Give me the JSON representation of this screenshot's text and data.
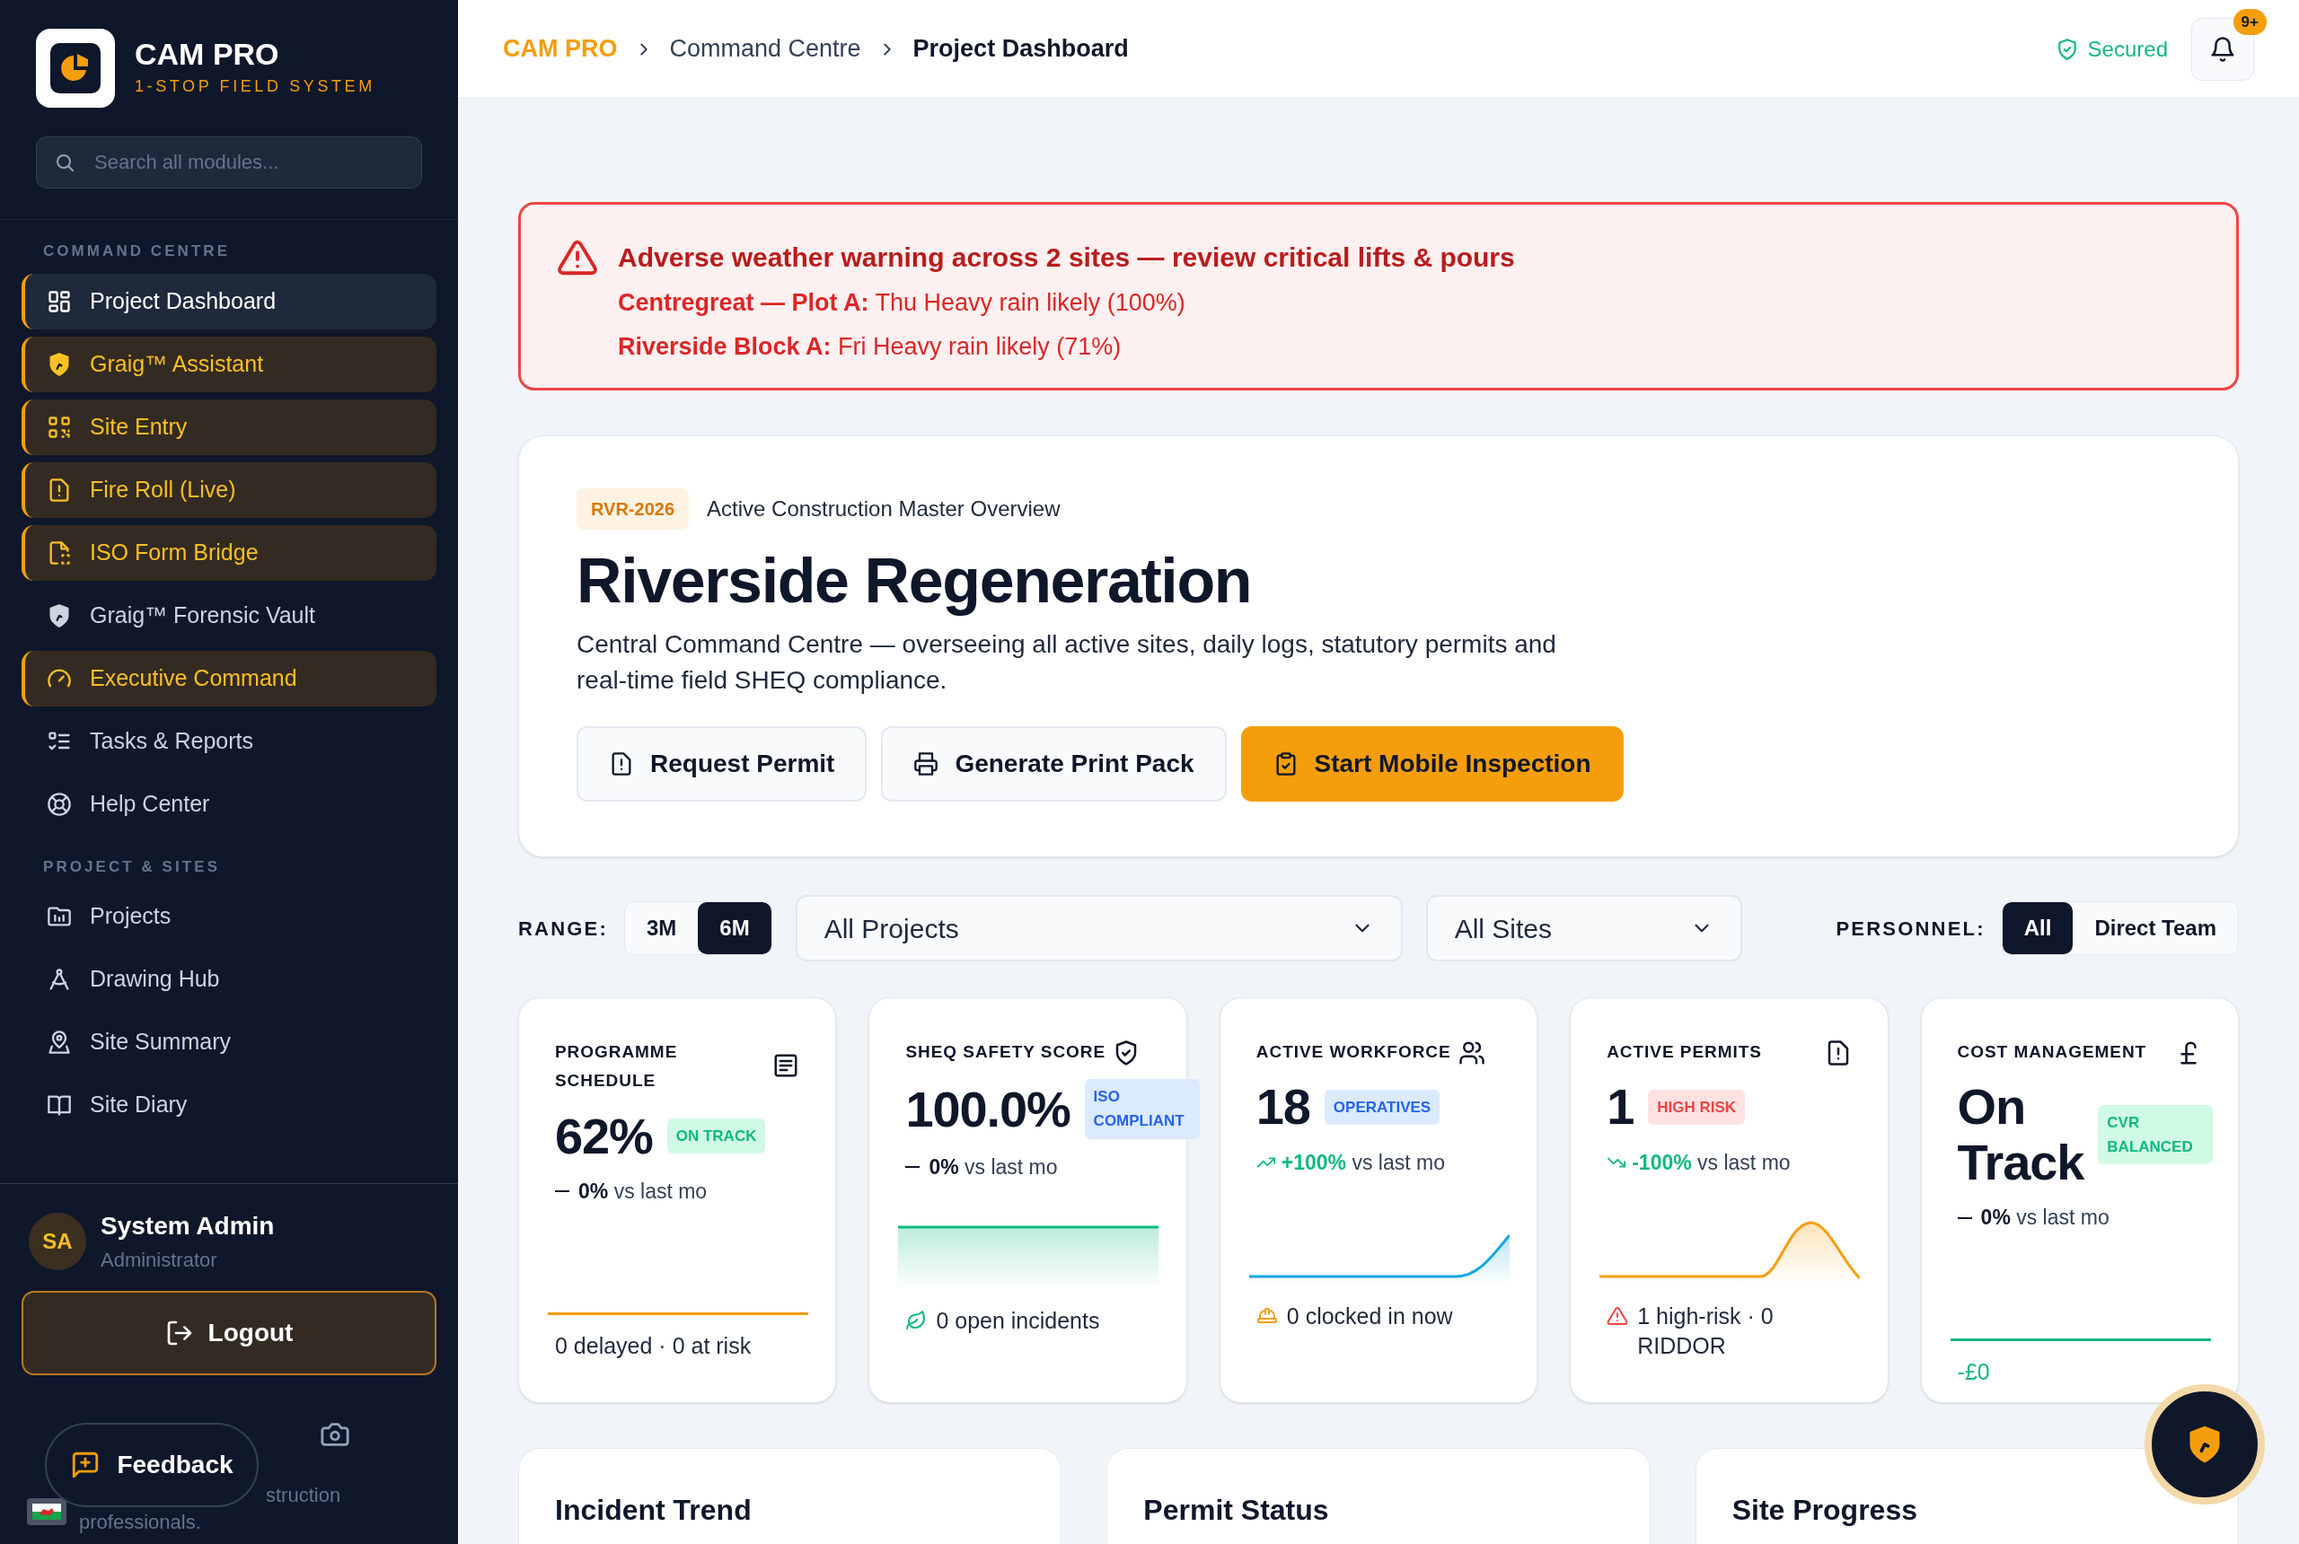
{
  "brand": {
    "name": "CAM PRO",
    "tagline": "1-STOP FIELD SYSTEM"
  },
  "search": {
    "placeholder": "Search all modules..."
  },
  "nav_sections": [
    {
      "title": "COMMAND CENTRE",
      "items": [
        {
          "label": "Project Dashboard",
          "selected": true,
          "highlighted": false
        },
        {
          "label": "Graig™ Assistant",
          "selected": false,
          "highlighted": true
        },
        {
          "label": "Site Entry",
          "selected": false,
          "highlighted": true
        },
        {
          "label": "Fire Roll (Live)",
          "selected": false,
          "highlighted": true
        },
        {
          "label": "ISO Form Bridge",
          "selected": false,
          "highlighted": true
        },
        {
          "label": "Graig™ Forensic Vault",
          "selected": false,
          "highlighted": false
        },
        {
          "label": "Executive Command",
          "selected": false,
          "highlighted": true
        },
        {
          "label": "Tasks & Reports",
          "selected": false,
          "highlighted": false
        },
        {
          "label": "Help Center",
          "selected": false,
          "highlighted": false
        }
      ]
    },
    {
      "title": "PROJECT & SITES",
      "items": [
        {
          "label": "Projects",
          "selected": false,
          "highlighted": false
        },
        {
          "label": "Drawing Hub",
          "selected": false,
          "highlighted": false
        },
        {
          "label": "Site Summary",
          "selected": false,
          "highlighted": false
        },
        {
          "label": "Site Diary",
          "selected": false,
          "highlighted": false
        }
      ]
    }
  ],
  "user": {
    "initials": "SA",
    "name": "System Admin",
    "role": "Administrator"
  },
  "logout": "Logout",
  "feedback": "Feedback",
  "footer_note": [
    "struction",
    "professionals."
  ],
  "breadcrumb": [
    "CAM PRO",
    "Command Centre",
    "Project Dashboard"
  ],
  "security": "Secured",
  "notifications": {
    "badge": "9+"
  },
  "alert": {
    "title": "Adverse weather warning across 2 sites — review critical lifts & pours",
    "lines": [
      "**Centregreat — Plot A:** Thu Heavy rain likely (100%)",
      "**Riverside Block A:** Fri Heavy rain likely (71%)"
    ]
  },
  "project": {
    "code": "RVR-2026",
    "subtitle": "Active Construction Master Overview",
    "title": "Riverside Regeneration",
    "description": "Central Command Centre — overseeing all active sites, daily logs, statutory permits and real-time field SHEQ compliance.",
    "actions": [
      {
        "label": "Request Permit",
        "primary": false
      },
      {
        "label": "Generate Print Pack",
        "primary": false
      },
      {
        "label": "Start Mobile Inspection",
        "primary": true
      }
    ]
  },
  "filters": {
    "range_label": "RANGE:",
    "ranges": [
      {
        "label": "3M",
        "selected": false
      },
      {
        "label": "6M",
        "selected": true
      }
    ],
    "project_select": "All Projects",
    "site_select": "All Sites",
    "personnel_label": "PERSONNEL:",
    "personnel": [
      {
        "label": "All",
        "selected": true
      },
      {
        "label": "Direct Team",
        "selected": false
      }
    ]
  },
  "kpis": [
    {
      "title": "PROGRAMME SCHEDULE",
      "value": "62%",
      "badge": "ON TRACK",
      "change": "**0%** vs last mo",
      "sparkline": {
        "color": "#f59e0b"
      },
      "footer": "0 delayed · 0 at risk"
    },
    {
      "title": "SHEQ SAFETY SCORE",
      "value": "100.0%",
      "badge": "ISO COMPLIANT",
      "change": "**0%** vs last mo",
      "sparkline": {
        "color": "#10b981"
      },
      "footer": "0 open incidents"
    },
    {
      "title": "ACTIVE WORKFORCE",
      "value": "18",
      "badge": "OPERATIVES",
      "change": "**+100%** vs last mo",
      "sparkline": {
        "color": "#0ea5e9"
      },
      "footer": "0 clocked in now"
    },
    {
      "title": "ACTIVE PERMITS",
      "value": "1",
      "badge": "HIGH RISK",
      "change": "**-100%** vs last mo",
      "sparkline": {
        "color": "#f59e0b"
      },
      "footer": "1 high-risk · 0 RIDDOR"
    },
    {
      "title": "COST MANAGEMENT",
      "value": "On Track",
      "badge": "CVR BALANCED",
      "change": "**0%** vs last mo",
      "sparkline": {
        "color": "#10b981"
      },
      "footer": "-£0"
    }
  ],
  "panels": [
    {
      "title": "Incident Trend"
    },
    {
      "title": "Permit Status"
    },
    {
      "title": "Site Progress"
    }
  ]
}
